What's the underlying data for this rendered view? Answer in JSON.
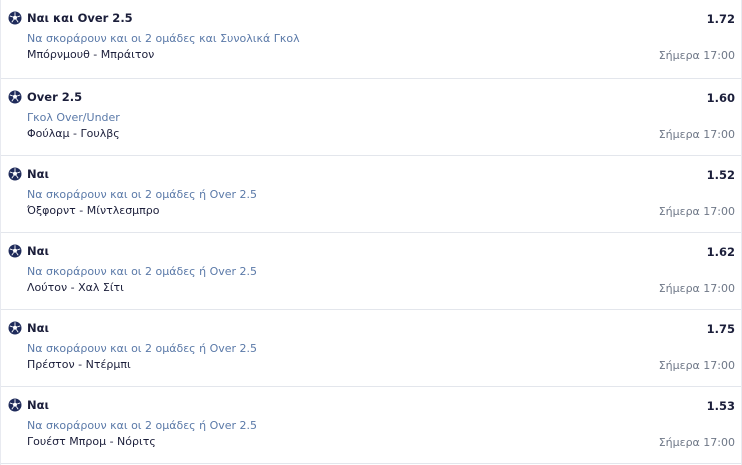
{
  "bets": [
    {
      "icon": "soccer-ball-icon",
      "selection": "Ναι και Over 2.5",
      "odds": "1.72",
      "market": "Να σκοράρουν και οι 2 ομάδες και Συνολικά Γκολ",
      "event": "Μπόρνμουθ - Μπράιτον",
      "time": "Σήμερα 17:00"
    },
    {
      "icon": "soccer-ball-icon",
      "selection": "Over 2.5",
      "odds": "1.60",
      "market": "Γκολ Over/Under",
      "event": "Φούλαμ - Γουλβς",
      "time": "Σήμερα 17:00"
    },
    {
      "icon": "soccer-ball-icon",
      "selection": "Ναι",
      "odds": "1.52",
      "market": "Να σκοράρουν και οι 2 ομάδες ή Over 2.5",
      "event": "Όξφορντ - Μίντλεσμπρο",
      "time": "Σήμερα 17:00"
    },
    {
      "icon": "soccer-ball-icon",
      "selection": "Ναι",
      "odds": "1.62",
      "market": "Να σκοράρουν και οι 2 ομάδες ή Over 2.5",
      "event": "Λούτον - Χαλ Σίτι",
      "time": "Σήμερα 17:00"
    },
    {
      "icon": "soccer-ball-icon",
      "selection": "Ναι",
      "odds": "1.75",
      "market": "Να σκοράρουν και οι 2 ομάδες ή Over 2.5",
      "event": "Πρέστον - Ντέρμπι",
      "time": "Σήμερα 17:00"
    },
    {
      "icon": "soccer-ball-icon",
      "selection": "Ναι",
      "odds": "1.53",
      "market": "Να σκοράρουν και οι 2 ομάδες ή Over 2.5",
      "event": "Γουέστ Μπρομ - Νόριτς",
      "time": "Σήμερα 17:00"
    }
  ],
  "colors": {
    "text": "#1b1e3a",
    "market": "#5a79a8",
    "time": "#6e7787",
    "divider": "#e3e6ec",
    "ball": "#1e2a5a"
  }
}
